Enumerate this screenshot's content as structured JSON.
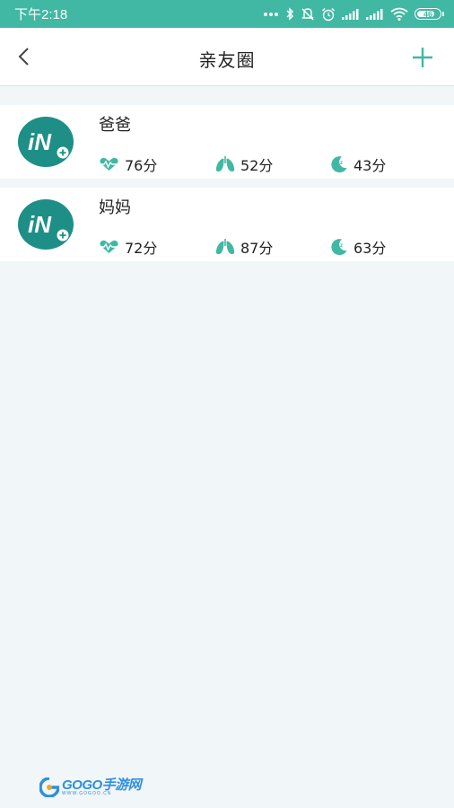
{
  "statusbar": {
    "time": "下午2:18",
    "icons": [
      "more-dots-icon",
      "bluetooth-icon",
      "mute-icon",
      "alarm-icon",
      "signal-icon",
      "signal-icon",
      "wifi-icon",
      "battery-icon"
    ],
    "battery": "46"
  },
  "navbar": {
    "title": "亲友圈",
    "back_icon": "chevron-left-icon",
    "add_icon": "plus-icon"
  },
  "colors": {
    "accent": "#41b8a3",
    "avatar": "#1e8f86",
    "background": "#f1f6f9"
  },
  "contacts": [
    {
      "name": "爸爸",
      "avatar_text": "iN",
      "heart": "76分",
      "lung": "52分",
      "sleep": "43分"
    },
    {
      "name": "妈妈",
      "avatar_text": "iN",
      "heart": "72分",
      "lung": "87分",
      "sleep": "63分"
    }
  ],
  "watermark": {
    "text": "GOGO手游网",
    "sub": "WWW.GOGOO.CN"
  }
}
